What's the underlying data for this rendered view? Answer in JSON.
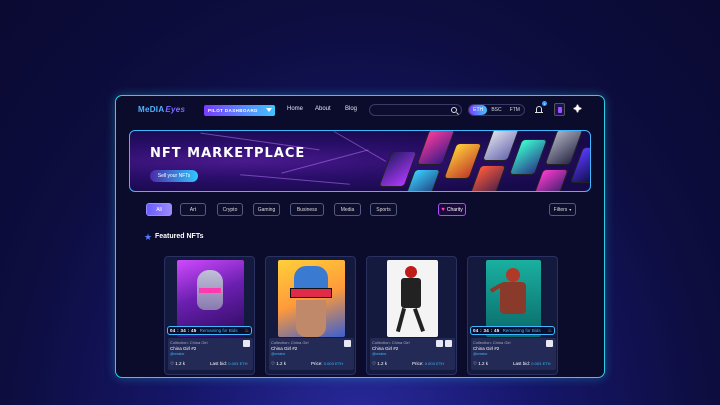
{
  "nav": {
    "logo": "MeDIA",
    "logo_suffix": "Eyes",
    "pilot_label": "PILOT DASHBOARD",
    "links": [
      "Home",
      "About",
      "Blog"
    ],
    "search_placeholder": "",
    "chains": [
      "ETH",
      "BSC",
      "FTM"
    ],
    "active_chain": "ETH",
    "notification_count": "1"
  },
  "banner": {
    "title": "NFT MARKETPLACE",
    "cta": "Sell your NFTs"
  },
  "filters": {
    "categories": [
      "All",
      "Art",
      "Crypto",
      "Gaming",
      "Business",
      "Media",
      "Sports"
    ],
    "active": "All",
    "charity": "Charity",
    "filters_label": "Filters"
  },
  "featured": {
    "title": "Featured NFTs"
  },
  "cards": [
    {
      "timer": "04 : 34 : 45",
      "remaining": "Remaining for Bids",
      "collection": "Collection: China Girl",
      "name": "China Girl #2",
      "creator": "@creator",
      "likes": "1.2 k",
      "price_label": "Last bid:",
      "price_value": "0.003",
      "price_alt": "ETH",
      "colors": [
        "#6a1fb0",
        "#e04aff",
        "#9a9ab0"
      ]
    },
    {
      "timer": "",
      "remaining": "",
      "collection": "Collection: China Girl",
      "name": "China Girl #2",
      "creator": "@creator",
      "likes": "1.2 k",
      "price_label": "Price:",
      "price_value": "0.003",
      "price_alt": "ETH",
      "colors": [
        "#3a5fd0",
        "#ffb03a",
        "#e02a4a"
      ]
    },
    {
      "timer": "",
      "remaining": "",
      "collection": "Collection: China Girl",
      "name": "China Girl #2",
      "creator": "@creator",
      "likes": "1.2 k",
      "price_label": "Price:",
      "price_value": "0.003",
      "price_alt": "ETH",
      "colors": [
        "#ffffff",
        "#c01a1a",
        "#111111"
      ]
    },
    {
      "timer": "04 : 34 : 45",
      "remaining": "Remaining for Bids",
      "collection": "Collection: China Girl",
      "name": "China Girl #2",
      "creator": "@creator",
      "likes": "1.2 k",
      "price_label": "Last bid:",
      "price_value": "0.003",
      "price_alt": "ETH",
      "colors": [
        "#1ab0a0",
        "#b03a2a",
        "#2a2a2a"
      ]
    }
  ]
}
